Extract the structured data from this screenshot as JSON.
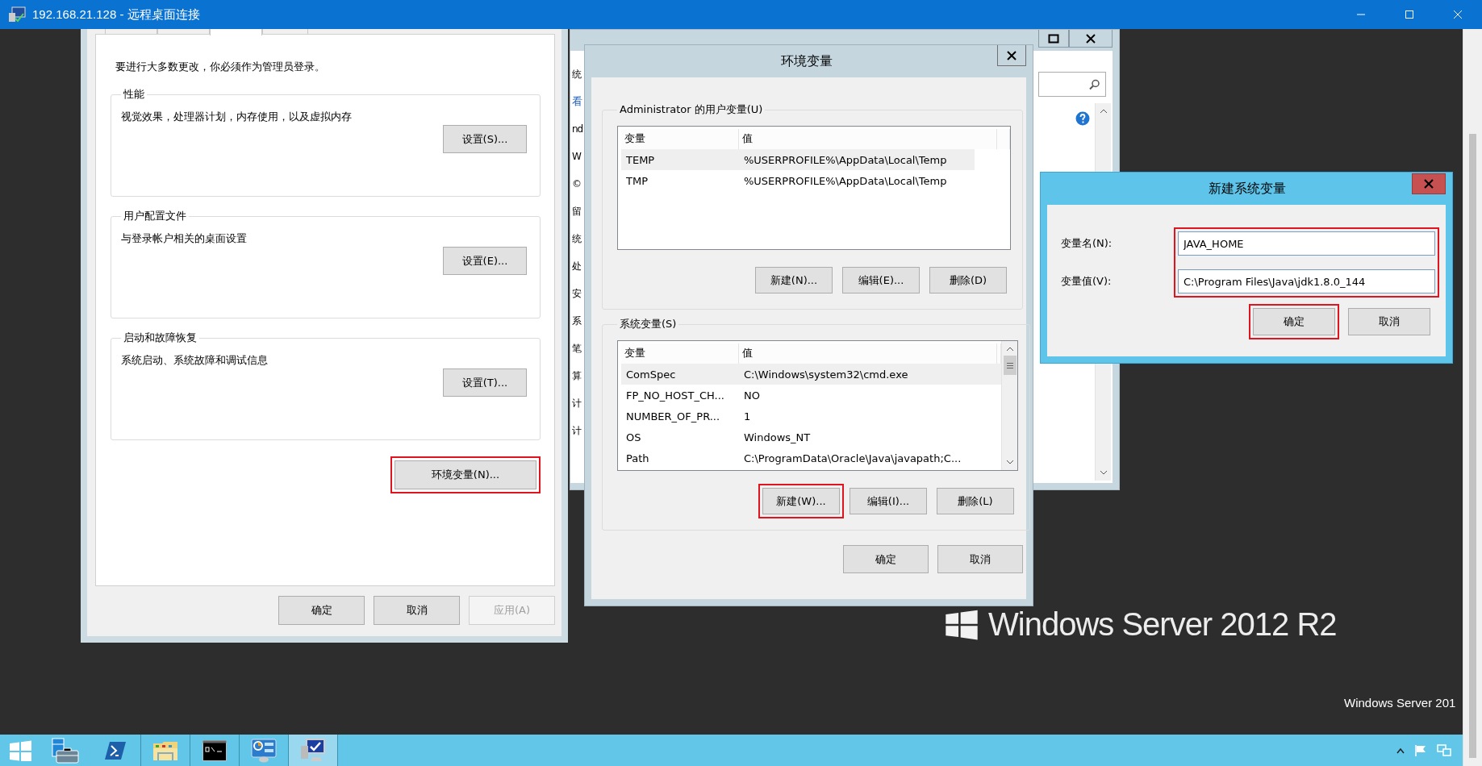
{
  "remote_desktop": {
    "title": "192.168.21.128 - 远程桌面连接"
  },
  "system_properties": {
    "tabs": [
      {
        "selected": false
      },
      {
        "selected": false
      },
      {
        "selected": true
      },
      {
        "selected": false
      }
    ],
    "notice": "要进行大多数更改，你必须作为管理员登录。",
    "groups": [
      {
        "title": "性能",
        "description": "视觉效果，处理器计划，内存使用，以及虚拟内存",
        "button": "设置(S)..."
      },
      {
        "title": "用户配置文件",
        "description": "与登录帐户相关的桌面设置",
        "button": "设置(E)..."
      },
      {
        "title": "启动和故障恢复",
        "description": "系统启动、系统故障和调试信息",
        "button": "设置(T)..."
      }
    ],
    "environment_button": {
      "label": "环境变量(N)...",
      "highlighted": true
    },
    "buttons": [
      {
        "label": "确定",
        "disabled": false
      },
      {
        "label": "取消",
        "disabled": false
      },
      {
        "label": "应用(A)",
        "disabled": true
      }
    ]
  },
  "system_window": {
    "fragments": [
      {
        "text": "统",
        "kind": "line"
      },
      {
        "text": "看",
        "kind": "link"
      },
      {
        "text": "nd",
        "kind": "line"
      },
      {
        "text": "W",
        "kind": "line"
      },
      {
        "text": "©",
        "kind": "line"
      },
      {
        "text": "留",
        "kind": "line"
      },
      {
        "text": "统",
        "kind": "line"
      },
      {
        "text": "处",
        "kind": "line"
      },
      {
        "text": "安",
        "kind": "line"
      },
      {
        "text": "系",
        "kind": "line"
      },
      {
        "text": "笔",
        "kind": "line"
      },
      {
        "text": "算",
        "kind": "line"
      },
      {
        "text": "计",
        "kind": "line"
      },
      {
        "text": "计",
        "kind": "line"
      }
    ]
  },
  "environment_variables": {
    "title": "环境变量",
    "groups": [
      {
        "title": "Administrator 的用户变量(U)",
        "columns": [
          "变量",
          "值"
        ],
        "scrollbar": false,
        "rows": [
          {
            "cells": [
              "TEMP",
              "%USERPROFILE%\\AppData\\Local\\Temp"
            ],
            "selected": true
          },
          {
            "cells": [
              "TMP",
              "%USERPROFILE%\\AppData\\Local\\Temp"
            ],
            "selected": false
          }
        ],
        "buttons": [
          {
            "label": "新建(N)...",
            "highlighted": false
          },
          {
            "label": "编辑(E)...",
            "highlighted": false
          },
          {
            "label": "删除(D)",
            "highlighted": false
          }
        ]
      },
      {
        "title": "系统变量(S)",
        "columns": [
          "变量",
          "值"
        ],
        "scrollbar": true,
        "rows": [
          {
            "cells": [
              "ComSpec",
              "C:\\Windows\\system32\\cmd.exe"
            ],
            "selected": true
          },
          {
            "cells": [
              "FP_NO_HOST_CH...",
              "NO"
            ],
            "selected": false
          },
          {
            "cells": [
              "NUMBER_OF_PR...",
              "1"
            ],
            "selected": false
          },
          {
            "cells": [
              "OS",
              "Windows_NT"
            ],
            "selected": false
          },
          {
            "cells": [
              "Path",
              "C:\\ProgramData\\Oracle\\Java\\javapath;C..."
            ],
            "selected": false
          }
        ],
        "buttons": [
          {
            "label": "新建(W)...",
            "highlighted": true
          },
          {
            "label": "编辑(I)...",
            "highlighted": false
          },
          {
            "label": "删除(L)",
            "highlighted": false
          }
        ]
      }
    ],
    "buttons": [
      {
        "label": "确定"
      },
      {
        "label": "取消"
      }
    ]
  },
  "new_variable_dialog": {
    "title": "新建系统变量",
    "fields_highlighted": true,
    "fields": [
      {
        "label": "变量名(N):",
        "value": "JAVA_HOME"
      },
      {
        "label": "变量值(V):",
        "value": "C:\\Program Files\\Java\\jdk1.8.0_144"
      }
    ],
    "buttons": [
      {
        "label": "确定",
        "highlighted": true
      },
      {
        "label": "取消",
        "highlighted": false
      }
    ]
  },
  "desktop": {
    "branding": "Windows Server 2012 R2",
    "corner_text": "Windows Server 201"
  },
  "taskbar": {
    "items": [
      {
        "kind": "start",
        "selected": false
      },
      {
        "kind": "server",
        "selected": false
      },
      {
        "kind": "shell",
        "selected": false
      },
      {
        "kind": "folder",
        "selected": false
      },
      {
        "kind": "console",
        "selected": false
      },
      {
        "kind": "panel",
        "selected": false
      },
      {
        "kind": "remote",
        "selected": true
      }
    ]
  }
}
